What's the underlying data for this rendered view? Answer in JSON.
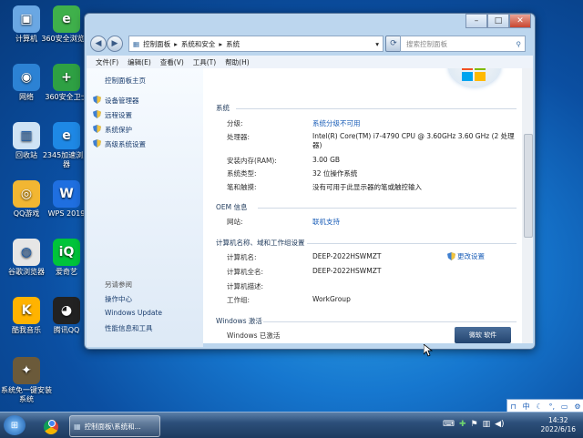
{
  "desktop_icons": [
    {
      "label": "计算机",
      "color": "#6aa7e3",
      "glyph": "▣",
      "icon": "computer-icon"
    },
    {
      "label": "360安全浏览器",
      "color": "#3fb04b",
      "glyph": "e",
      "icon": "browser-360-icon"
    },
    {
      "label": "网络",
      "color": "#2c82d4",
      "glyph": "◉",
      "icon": "network-icon"
    },
    {
      "label": "360安全卫士",
      "color": "#2ea043",
      "glyph": "+",
      "icon": "security-360-icon"
    },
    {
      "label": "回收站",
      "color": "#cfe3f5",
      "glyph": "▥",
      "icon": "recycle-bin-icon"
    },
    {
      "label": "2345加速浏览器",
      "color": "#1e88e5",
      "glyph": "e",
      "icon": "browser-2345-icon"
    },
    {
      "label": "QQ游戏",
      "color": "#f2b632",
      "glyph": "◎",
      "icon": "qq-game-icon"
    },
    {
      "label": "WPS 2019",
      "color": "#1f6fe0",
      "glyph": "W",
      "icon": "wps-icon"
    },
    {
      "label": "谷歌浏览器",
      "color": "#e6e6e6",
      "glyph": "◍",
      "icon": "chrome-icon"
    },
    {
      "label": "爱奇艺",
      "color": "#00c43a",
      "glyph": "iQ",
      "icon": "iqiyi-icon"
    },
    {
      "label": "酷我音乐",
      "color": "#ffb300",
      "glyph": "K",
      "icon": "kuwo-icon"
    },
    {
      "label": "腾讯QQ",
      "color": "#222222",
      "glyph": "◕",
      "icon": "qq-icon"
    },
    {
      "label": "系统免一键安装系统",
      "color": "#6b5a3a",
      "glyph": "✦",
      "icon": "system-install-icon"
    }
  ],
  "window": {
    "address": {
      "parts": [
        "控制面板",
        "系统和安全",
        "系统"
      ]
    },
    "search_placeholder": "搜索控制面板",
    "menu": [
      "文件(F)",
      "编辑(E)",
      "查看(V)",
      "工具(T)",
      "帮助(H)"
    ],
    "left_pane": {
      "home": "控制面板主页",
      "links": [
        "设备管理器",
        "远程设置",
        "系统保护",
        "高级系统设置"
      ],
      "see_also_title": "另请参阅",
      "see_also": [
        "操作中心",
        "Windows Update",
        "性能信息和工具"
      ]
    },
    "sections": {
      "system": {
        "title": "系统",
        "rows": [
          {
            "label": "分级:",
            "value": "系统分级不可用",
            "link": true
          },
          {
            "label": "处理器:",
            "value": "Intel(R) Core(TM) i7-4790 CPU @ 3.60GHz   3.60 GHz  (2 处理器)",
            "link": false
          },
          {
            "label": "安装内存(RAM):",
            "value": "3.00 GB",
            "link": false
          },
          {
            "label": "系统类型:",
            "value": "32 位操作系统",
            "link": false
          },
          {
            "label": "笔和触摸:",
            "value": "没有可用于此显示器的笔或触控输入",
            "link": false
          }
        ]
      },
      "oem": {
        "title": "OEM 信息",
        "rows": [
          {
            "label": "网站:",
            "value": "联机支持",
            "link": true
          }
        ]
      },
      "computer": {
        "title": "计算机名称、域和工作组设置",
        "change": "更改设置",
        "rows": [
          {
            "label": "计算机名:",
            "value": "DEEP-2022HSWMZT"
          },
          {
            "label": "计算机全名:",
            "value": "DEEP-2022HSWMZT"
          },
          {
            "label": "计算机描述:",
            "value": ""
          },
          {
            "label": "工作组:",
            "value": "WorkGroup"
          }
        ]
      },
      "activation": {
        "title": "Windows 激活",
        "status": "Windows 已激活",
        "badge": "微软 软件"
      }
    }
  },
  "taskbar": {
    "active_window": "控制面板\\系统和...",
    "time": "14:32",
    "date": "2022/6/16"
  },
  "ime_bar": {
    "lang": "中"
  }
}
